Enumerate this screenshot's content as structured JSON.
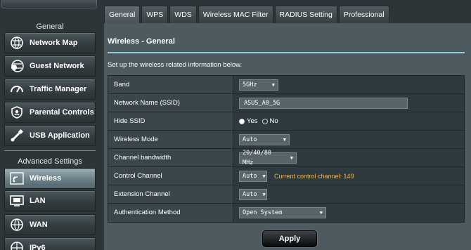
{
  "sidebar": {
    "general_title": "General",
    "advanced_title": "Advanced Settings",
    "general_items": [
      {
        "label": "Network Map",
        "icon": "network-map-icon"
      },
      {
        "label": "Guest Network",
        "icon": "guest-network-icon"
      },
      {
        "label": "Traffic Manager",
        "icon": "traffic-manager-icon"
      },
      {
        "label": "Parental Controls",
        "icon": "parental-controls-icon"
      },
      {
        "label": "USB Application",
        "icon": "usb-application-icon"
      }
    ],
    "advanced_items": [
      {
        "label": "Wireless",
        "icon": "wireless-icon",
        "active": true
      },
      {
        "label": "LAN",
        "icon": "lan-icon"
      },
      {
        "label": "WAN",
        "icon": "wan-icon"
      },
      {
        "label": "IPv6",
        "icon": "ipv6-icon"
      }
    ]
  },
  "tabs": [
    "General",
    "WPS",
    "WDS",
    "Wireless MAC Filter",
    "RADIUS Setting",
    "Professional"
  ],
  "panel": {
    "title": "Wireless - General",
    "description": "Set up the wireless related information below."
  },
  "form": {
    "band": {
      "label": "Band",
      "value": "5GHz"
    },
    "ssid": {
      "label": "Network Name (SSID)",
      "value": "ASUS_A0_5G"
    },
    "hide_ssid": {
      "label": "Hide SSID",
      "yes": "Yes",
      "no": "No",
      "selected": "Yes"
    },
    "wireless_mode": {
      "label": "Wireless Mode",
      "value": "Auto"
    },
    "channel_bandwidth": {
      "label": "Channel bandwidth",
      "value": "20/40/80 MHz"
    },
    "control_channel": {
      "label": "Control Channel",
      "value": "Auto",
      "hint": "Current control channel: 149"
    },
    "extension_channel": {
      "label": "Extension Channel",
      "value": "Auto"
    },
    "auth_method": {
      "label": "Authentication Method",
      "value": "Open System"
    }
  },
  "apply_label": "Apply",
  "colors": {
    "accent_line": "#93c9d8",
    "hint": "#f5b91f",
    "panel_bg": "#4d5a5f"
  }
}
